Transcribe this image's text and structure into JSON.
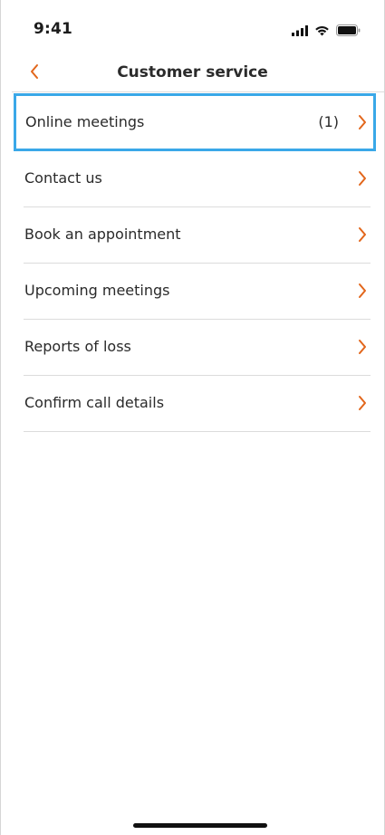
{
  "status_bar": {
    "time": "9:41",
    "icons": [
      "signal-icon",
      "wifi-icon",
      "battery-icon"
    ]
  },
  "nav": {
    "back_icon": "chevron-left-icon",
    "title": "Customer service"
  },
  "colors": {
    "accent": "#e2661b",
    "highlight": "#3aa8e8",
    "divider": "#dcdcdc"
  },
  "menu": {
    "items": [
      {
        "label": "Online meetings",
        "count": "(1)",
        "highlighted": true
      },
      {
        "label": "Contact us"
      },
      {
        "label": "Book an appointment"
      },
      {
        "label": "Upcoming meetings"
      },
      {
        "label": "Reports of loss"
      },
      {
        "label": "Confirm call details"
      }
    ]
  }
}
